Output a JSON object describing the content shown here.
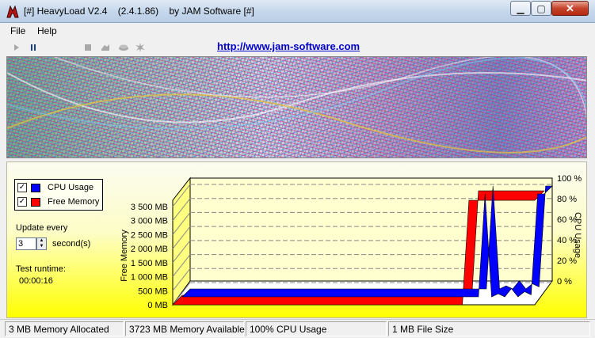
{
  "window": {
    "title": "[#] HeavyLoad V2.4    (2.4.1.86)    by JAM Software [#]",
    "minimize_icon": "minimize-icon",
    "maximize_icon": "maximize-icon",
    "close_icon": "close-icon",
    "app_icon": "heavyload-app-icon"
  },
  "menu": {
    "file": "File",
    "help": "Help"
  },
  "toolbar": {
    "items": [
      {
        "name": "start-icon",
        "enabled": false
      },
      {
        "name": "pause-icon",
        "enabled": true
      },
      {
        "name": "stop-icon",
        "enabled": false
      },
      {
        "name": "cpu-stress-icon",
        "enabled": false
      },
      {
        "name": "memory-stress-icon",
        "enabled": false
      },
      {
        "name": "disk-stress-icon",
        "enabled": false
      }
    ],
    "link": "http://www.jam-software.com"
  },
  "legend": {
    "cpu": {
      "label": "CPU Usage",
      "checked": true,
      "color": "#0000ff"
    },
    "mem": {
      "label": "Free Memory",
      "checked": true,
      "color": "#ff0000"
    }
  },
  "controls": {
    "update_label": "Update every",
    "interval_value": "3",
    "seconds_label": "second(s)",
    "runtime_label": "Test runtime:",
    "runtime_value": "00:00:16"
  },
  "chart_data": {
    "type": "area",
    "left_axis": {
      "label": "Free Memory",
      "ticks": [
        "0 MB",
        "500 MB",
        "1 000 MB",
        "1 500 MB",
        "2 000 MB",
        "2 500 MB",
        "3 000 MB",
        "3 500 MB"
      ],
      "range": [
        0,
        3500
      ]
    },
    "right_axis": {
      "label": "CPU Usage",
      "ticks": [
        "0 %",
        "20 %",
        "40 %",
        "60 %",
        "80 %",
        "100 %"
      ],
      "range": [
        0,
        100
      ]
    },
    "series": [
      {
        "name": "CPU Usage",
        "color": "#0000ff",
        "unit": "%",
        "values": [
          0,
          0,
          0,
          0,
          0,
          0,
          0,
          0,
          0,
          0,
          0,
          0,
          0,
          0,
          0,
          0,
          0,
          0,
          0,
          0,
          0,
          0,
          0,
          0,
          0,
          0,
          0,
          0,
          0,
          0,
          0,
          0,
          0,
          0,
          0,
          0,
          0,
          0,
          0,
          0,
          0,
          0,
          0,
          0,
          0,
          0,
          100,
          0,
          3,
          -2,
          8,
          0,
          5,
          2,
          100,
          100
        ]
      },
      {
        "name": "Free Memory",
        "color": "#ff0000",
        "unit": "MB",
        "values": [
          0,
          0,
          0,
          0,
          0,
          0,
          0,
          0,
          0,
          0,
          0,
          0,
          0,
          0,
          0,
          0,
          0,
          0,
          0,
          0,
          0,
          0,
          0,
          0,
          0,
          0,
          0,
          0,
          0,
          0,
          0,
          0,
          0,
          0,
          0,
          0,
          0,
          0,
          0,
          0,
          0,
          0,
          0,
          0,
          0,
          3723,
          3723,
          3723,
          3723,
          3723,
          3723,
          3723,
          3723,
          3723,
          3723,
          3723
        ]
      }
    ],
    "grid": true
  },
  "status": {
    "memory_allocated": "3 MB Memory Allocated",
    "memory_available": "3723 MB Memory Available",
    "cpu_usage": "100% CPU Usage",
    "file_size": "1 MB File Size"
  }
}
